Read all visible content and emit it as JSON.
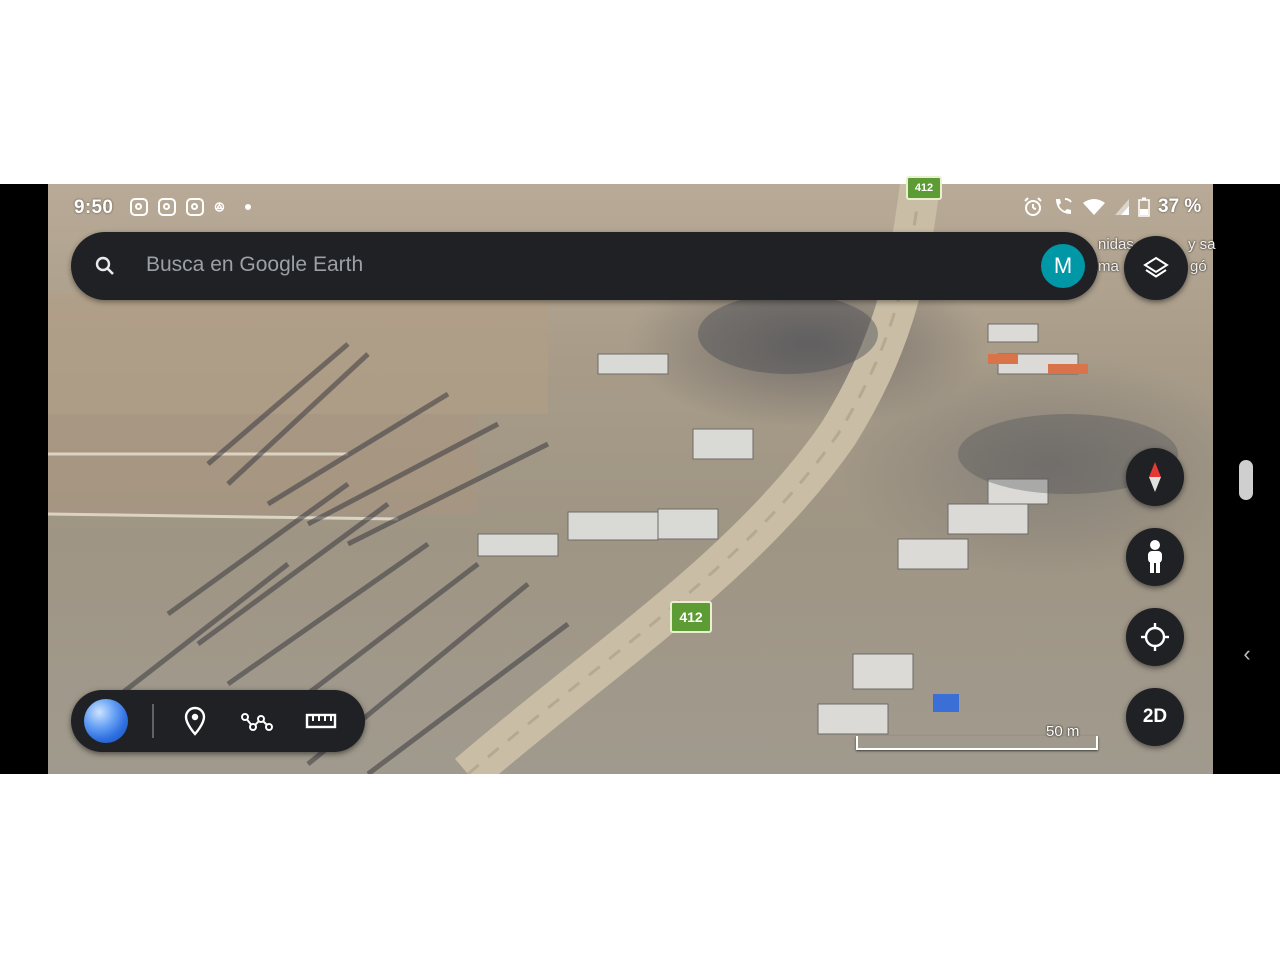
{
  "status_bar": {
    "time": "9:50",
    "battery": "37 %"
  },
  "search": {
    "placeholder": "Busca en Google Earth",
    "avatar_letter": "M"
  },
  "map": {
    "route_label": "412",
    "route_label_top": "412",
    "scale_label": "50 m",
    "overlay_line1": "nidas",
    "overlay_line2": "ma",
    "overlay_right1": "y sa",
    "overlay_right2": "gó"
  },
  "controls": {
    "view_mode": "2D"
  },
  "icons": {
    "layers": "layers-icon",
    "compass": "compass-icon",
    "pegman": "pegman-icon",
    "my_location": "my-location-icon",
    "place_marker": "place-marker-icon",
    "path": "path-icon",
    "ruler": "ruler-icon"
  },
  "colors": {
    "bar_bg": "#202124",
    "avatar_bg": "#0097a7",
    "shield_green": "#5d9b35",
    "compass_red": "#e53935"
  }
}
